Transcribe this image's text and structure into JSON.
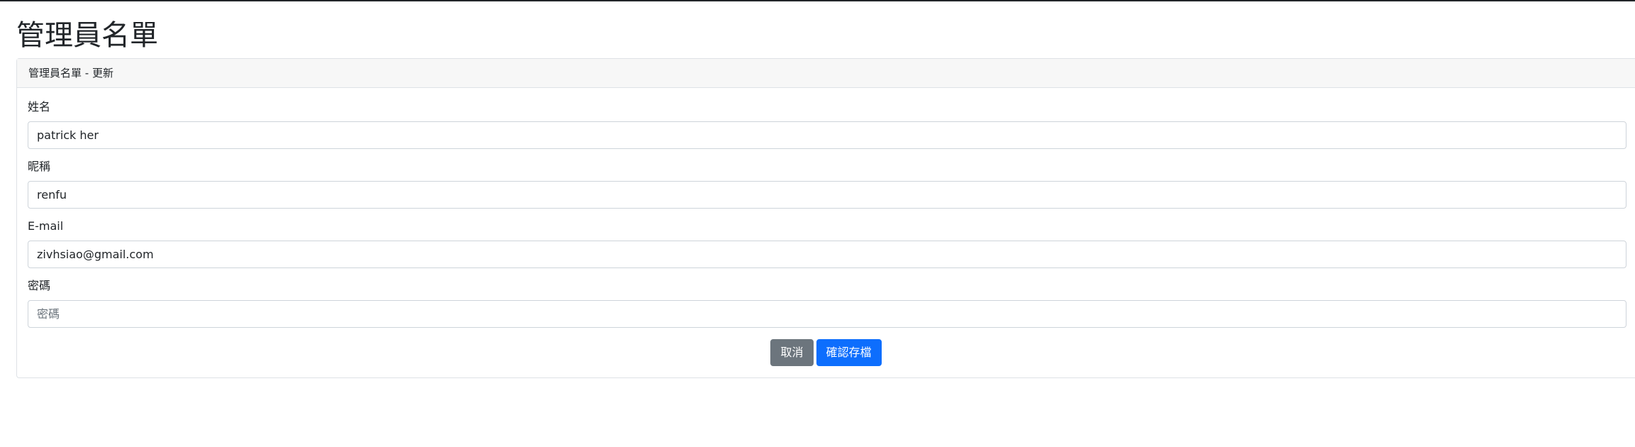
{
  "page": {
    "title": "管理員名單"
  },
  "card": {
    "header": "管理員名單 - 更新"
  },
  "form": {
    "name": {
      "label": "姓名",
      "value": "patrick her",
      "placeholder": ""
    },
    "nickname": {
      "label": "昵稱",
      "value": "renfu",
      "placeholder": ""
    },
    "email": {
      "label": "E-mail",
      "value": "zivhsiao@gmail.com",
      "placeholder": ""
    },
    "password": {
      "label": "密碼",
      "value": "",
      "placeholder": "密碼"
    }
  },
  "actions": {
    "cancel_label": "取消",
    "save_label": "確認存檔"
  },
  "colors": {
    "primary": "#0d6efd",
    "secondary": "#6c757d",
    "header_bg": "#f7f7f7",
    "border": "#dee2e6"
  }
}
